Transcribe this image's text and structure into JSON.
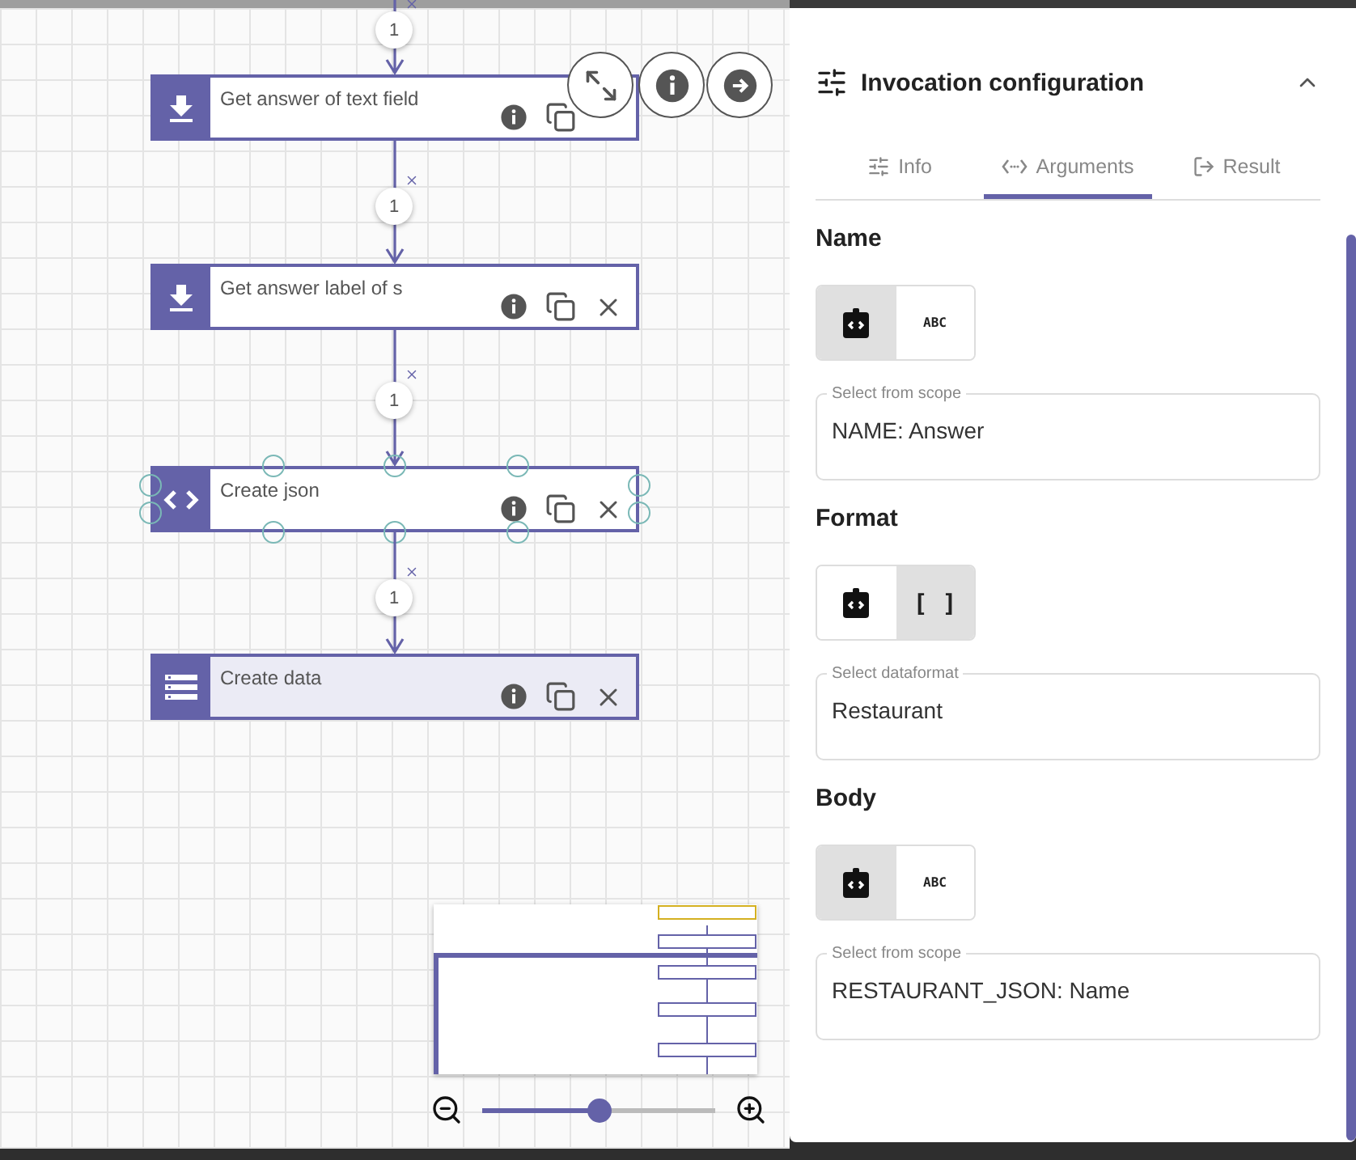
{
  "flow": {
    "entry_badge": "1",
    "nodes": [
      {
        "title": "Get answer of text field",
        "kind": "download",
        "selected": false,
        "hovered": true,
        "highlighted": false,
        "badge": "1"
      },
      {
        "title": "Get answer label of s",
        "kind": "download",
        "selected": false,
        "hovered": false,
        "highlighted": false,
        "badge": "1"
      },
      {
        "title": "Create json",
        "kind": "code",
        "selected": true,
        "hovered": false,
        "highlighted": false,
        "badge": "1"
      },
      {
        "title": "Create data",
        "kind": "list",
        "selected": false,
        "hovered": false,
        "highlighted": true
      }
    ]
  },
  "zoom": {
    "level": 0.5
  },
  "panel": {
    "title": "Invocation configuration",
    "expanded": true,
    "tabs": [
      {
        "label": "Info",
        "kind": "info",
        "selected": false
      },
      {
        "label": "Arguments",
        "kind": "arguments",
        "selected": true
      },
      {
        "label": "Result",
        "kind": "result",
        "selected": false
      }
    ],
    "sections": [
      {
        "title": "Name",
        "options": [
          {
            "kind": "scope",
            "selected": true
          },
          {
            "kind": "text",
            "label": "ABC",
            "selected": false
          }
        ],
        "field": {
          "label": "Select from scope",
          "value": "NAME: Answer"
        }
      },
      {
        "title": "Format",
        "options": [
          {
            "kind": "scope",
            "selected": false
          },
          {
            "kind": "text",
            "label": "[ ]",
            "selected": true
          }
        ],
        "field": {
          "label": "Select dataformat",
          "value": "Restaurant"
        }
      },
      {
        "title": "Body",
        "options": [
          {
            "kind": "scope",
            "selected": true
          },
          {
            "kind": "text",
            "label": "ABC",
            "selected": false
          }
        ],
        "field": {
          "label": "Select from scope",
          "value": "RESTAURANT_JSON: Name"
        }
      }
    ]
  }
}
